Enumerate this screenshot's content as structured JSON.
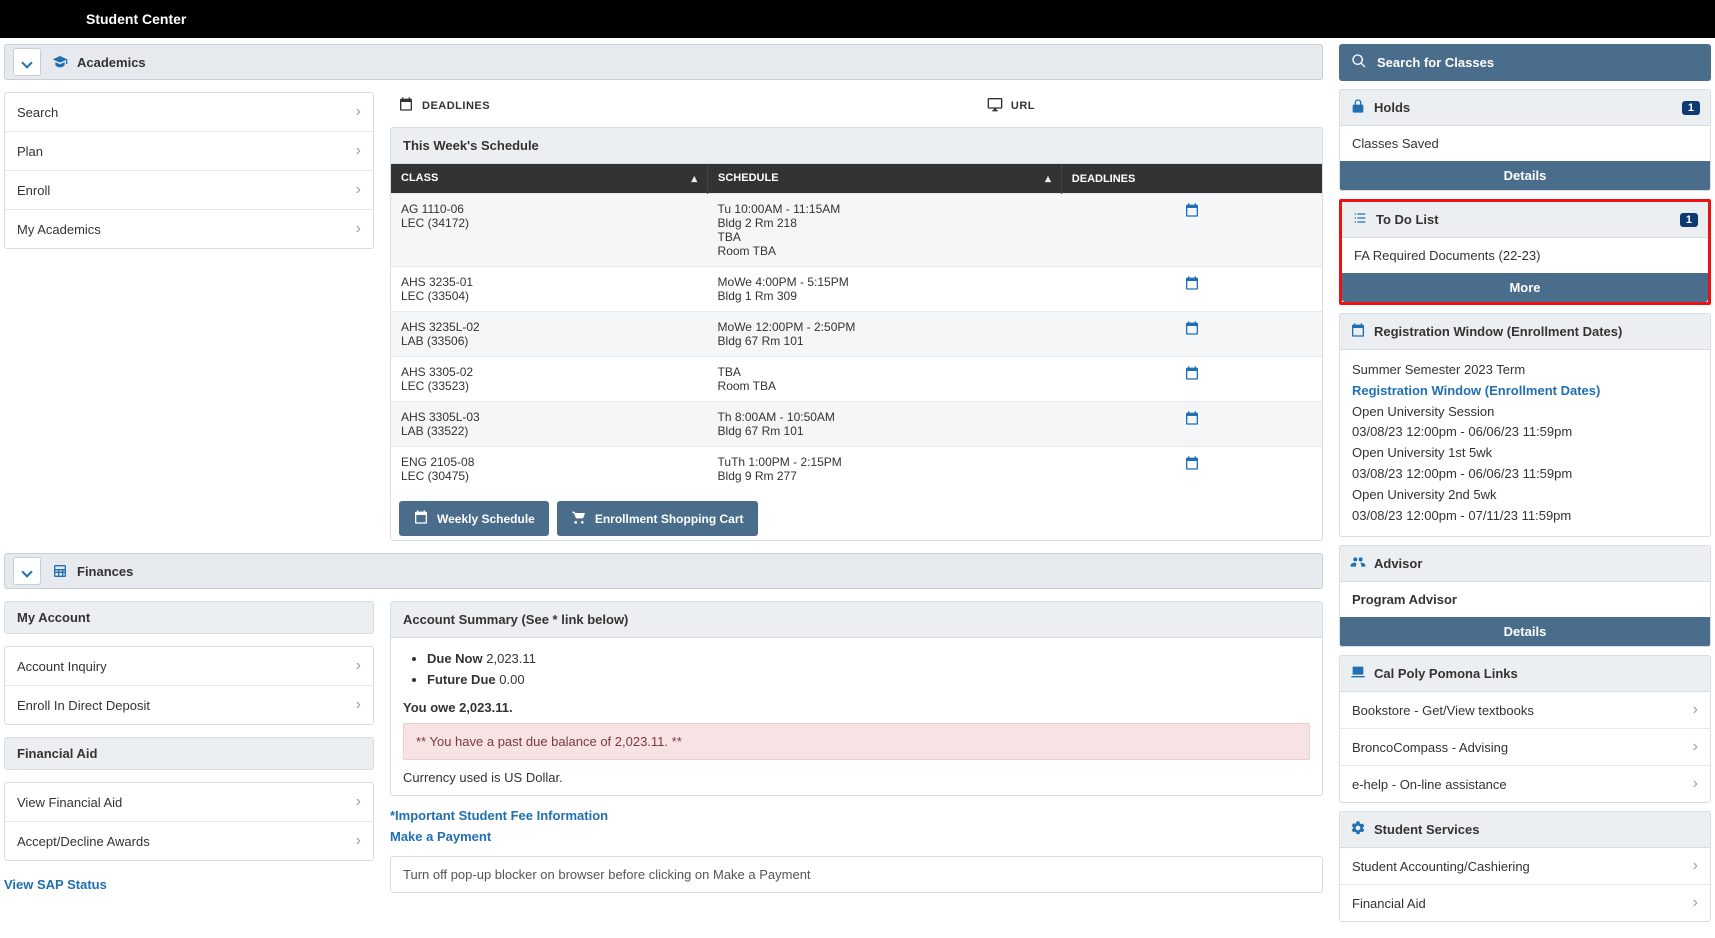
{
  "topbar": {
    "title": "Student Center"
  },
  "academics": {
    "header": "Academics",
    "menu": [
      "Search",
      "Plan",
      "Enroll",
      "My Academics"
    ]
  },
  "midtop": {
    "deadlines_label": "DEADLINES",
    "url_label": "URL"
  },
  "schedule": {
    "title": "This Week's Schedule",
    "columns": {
      "class": "CLASS",
      "schedule": "SCHEDULE",
      "deadlines": "DEADLINES"
    },
    "rows": [
      {
        "class_l1": "AG 1110-06",
        "class_l2": "LEC (34172)",
        "sched_l1": "Tu 10:00AM - 11:15AM",
        "sched_l2": "Bldg 2 Rm 218",
        "sched_l3": "TBA",
        "sched_l4": "Room  TBA"
      },
      {
        "class_l1": "AHS 3235-01",
        "class_l2": "LEC (33504)",
        "sched_l1": "MoWe 4:00PM - 5:15PM",
        "sched_l2": "Bldg 1 Rm 309",
        "sched_l3": "",
        "sched_l4": ""
      },
      {
        "class_l1": "AHS 3235L-02",
        "class_l2": "LAB (33506)",
        "sched_l1": "MoWe 12:00PM - 2:50PM",
        "sched_l2": "Bldg 67 Rm 101",
        "sched_l3": "",
        "sched_l4": ""
      },
      {
        "class_l1": "AHS 3305-02",
        "class_l2": "LEC (33523)",
        "sched_l1": "TBA",
        "sched_l2": "Room  TBA",
        "sched_l3": "",
        "sched_l4": ""
      },
      {
        "class_l1": "AHS 3305L-03",
        "class_l2": "LAB (33522)",
        "sched_l1": "Th 8:00AM - 10:50AM",
        "sched_l2": "Bldg 67 Rm 101",
        "sched_l3": "",
        "sched_l4": ""
      },
      {
        "class_l1": "ENG 2105-08",
        "class_l2": "LEC (30475)",
        "sched_l1": "TuTh 1:00PM - 2:15PM",
        "sched_l2": "Bldg 9 Rm 277",
        "sched_l3": "",
        "sched_l4": ""
      }
    ],
    "weekly_btn": "Weekly Schedule",
    "cart_btn": "Enrollment Shopping Cart"
  },
  "finances": {
    "header": "Finances",
    "my_account_header": "My Account",
    "account_menu": [
      "Account Inquiry",
      "Enroll In Direct Deposit"
    ],
    "financial_aid_header": "Financial Aid",
    "fa_menu": [
      "View Financial Aid",
      "Accept/Decline Awards"
    ],
    "sap_link": "View SAP Status",
    "summary_title": "Account Summary (See * link below)",
    "due_now_label": "Due Now",
    "due_now_val": "2,023.11",
    "future_due_label": "Future Due",
    "future_due_val": "0.00",
    "you_owe": "You owe 2,023.11.",
    "past_due_msg": "** You have a past due balance of 2,023.11. **",
    "currency_note": "Currency used is US Dollar.",
    "fee_info_link": "*Important Student Fee Information",
    "make_payment_link": "Make a Payment",
    "popup_note": "Turn off pop-up blocker on browser before clicking on Make a Payment"
  },
  "right": {
    "search_classes": "Search for Classes",
    "holds": {
      "title": "Holds",
      "badge": "1",
      "item": "Classes Saved",
      "details": "Details"
    },
    "todo": {
      "title": "To Do List",
      "badge": "1",
      "item": "FA Required Documents (22-23)",
      "more": "More"
    },
    "reg": {
      "title": "Registration Window (Enrollment Dates)",
      "term": "Summer Semester 2023 Term",
      "link": "Registration Window (Enrollment Dates)",
      "lines": [
        "Open University Session",
        "03/08/23 12:00pm - 06/06/23 11:59pm",
        "Open University 1st 5wk",
        "03/08/23 12:00pm - 06/06/23 11:59pm",
        "Open University 2nd 5wk",
        "03/08/23 12:00pm - 07/11/23 11:59pm"
      ]
    },
    "advisor": {
      "title": "Advisor",
      "value": "Program Advisor",
      "details": "Details"
    },
    "cpp": {
      "title": "Cal Poly Pomona Links",
      "items": [
        "Bookstore - Get/View textbooks",
        "BroncoCompass - Advising",
        "e-help - On-line assistance"
      ]
    },
    "services": {
      "title": "Student Services",
      "items": [
        "Student Accounting/Cashiering",
        "Financial Aid"
      ]
    }
  }
}
